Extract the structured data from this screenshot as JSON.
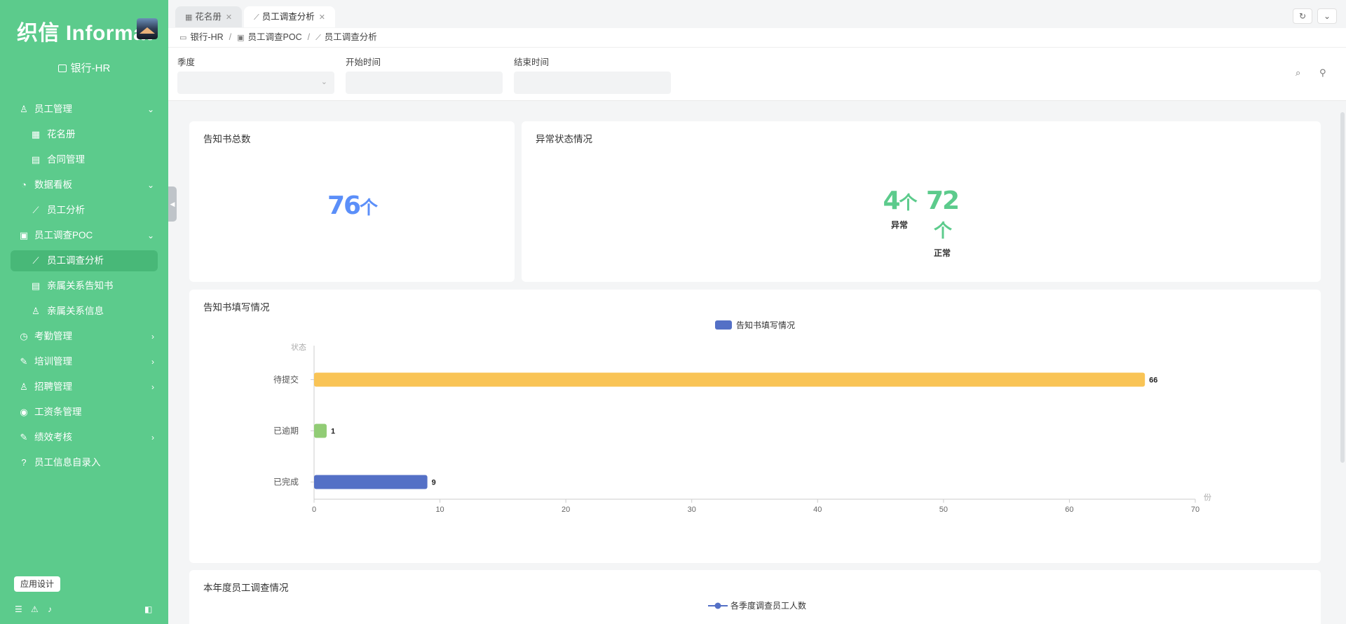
{
  "sidebar": {
    "logo": "织信 Informat",
    "app_name": "银行-HR",
    "menu": [
      {
        "label": "员工管理",
        "icon": "user-icon",
        "glyph": "♙",
        "arrow": "⌄",
        "sub": false,
        "active": false
      },
      {
        "label": "花名册",
        "icon": "table-icon",
        "glyph": "▦",
        "arrow": "",
        "sub": true,
        "active": false
      },
      {
        "label": "合同管理",
        "icon": "document-icon",
        "glyph": "▤",
        "arrow": "",
        "sub": true,
        "active": false
      },
      {
        "label": "数据看板",
        "icon": "pie-chart-icon",
        "glyph": "◔",
        "arrow": "⌄",
        "sub": false,
        "active": false
      },
      {
        "label": "员工分析",
        "icon": "line-chart-icon",
        "glyph": "⟋",
        "arrow": "",
        "sub": true,
        "active": false
      },
      {
        "label": "员工调查POC",
        "icon": "contact-card-icon",
        "glyph": "▣",
        "arrow": "⌄",
        "sub": false,
        "active": false
      },
      {
        "label": "员工调查分析",
        "icon": "line-chart-icon",
        "glyph": "⟋",
        "arrow": "",
        "sub": true,
        "active": true
      },
      {
        "label": "亲属关系告知书",
        "icon": "document-icon",
        "glyph": "▤",
        "arrow": "",
        "sub": true,
        "active": false
      },
      {
        "label": "亲属关系信息",
        "icon": "users-icon",
        "glyph": "♙",
        "arrow": "",
        "sub": true,
        "active": false
      },
      {
        "label": "考勤管理",
        "icon": "clock-icon",
        "glyph": "◷",
        "arrow": "›",
        "sub": false,
        "active": false
      },
      {
        "label": "培训管理",
        "icon": "pencil-icon",
        "glyph": "✎",
        "arrow": "›",
        "sub": false,
        "active": false
      },
      {
        "label": "招聘管理",
        "icon": "user-list-icon",
        "glyph": "♙",
        "arrow": "›",
        "sub": false,
        "active": false
      },
      {
        "label": "工资条管理",
        "icon": "coin-icon",
        "glyph": "◉",
        "arrow": "",
        "sub": false,
        "active": false
      },
      {
        "label": "绩效考核",
        "icon": "pencil-icon",
        "glyph": "✎",
        "arrow": "›",
        "sub": false,
        "active": false
      },
      {
        "label": "员工信息自录入",
        "icon": "help-circle-icon",
        "glyph": "?",
        "arrow": "",
        "sub": false,
        "active": false
      }
    ],
    "design_button": "应用设计"
  },
  "tabs": [
    {
      "label": "花名册",
      "active": false
    },
    {
      "label": "员工调查分析",
      "active": true
    }
  ],
  "breadcrumb": [
    "银行-HR",
    "员工调查POC",
    "员工调查分析"
  ],
  "filters": {
    "quarter_label": "季度",
    "start_label": "开始时间",
    "end_label": "结束时间"
  },
  "cards": {
    "total": {
      "title": "告知书总数",
      "value": "76",
      "unit": "个",
      "color": "#5b8ff9"
    },
    "abnormal": {
      "title": "异常状态情况",
      "items": [
        {
          "value": "4",
          "unit": "个",
          "label": "异常"
        },
        {
          "value": "72",
          "unit": "个",
          "label": "正常"
        }
      ],
      "color": "#5ccb8c"
    },
    "fill": {
      "title": "告知书填写情况"
    },
    "yearly": {
      "title": "本年度员工调查情况",
      "legend": "各季度调查员工人数"
    }
  },
  "chart_data": {
    "type": "bar",
    "orientation": "horizontal",
    "legend": "告知书填写情况",
    "ylabel": "状态",
    "xlabel": "份",
    "categories": [
      "待提交",
      "已逾期",
      "已完成"
    ],
    "values": [
      66,
      1,
      9
    ],
    "colors": [
      "#f9c456",
      "#91cc75",
      "#5470c6"
    ],
    "legend_color": "#5470c6",
    "xlim": [
      0,
      70
    ],
    "xticks": [
      0,
      10,
      20,
      30,
      40,
      50,
      60,
      70
    ]
  }
}
